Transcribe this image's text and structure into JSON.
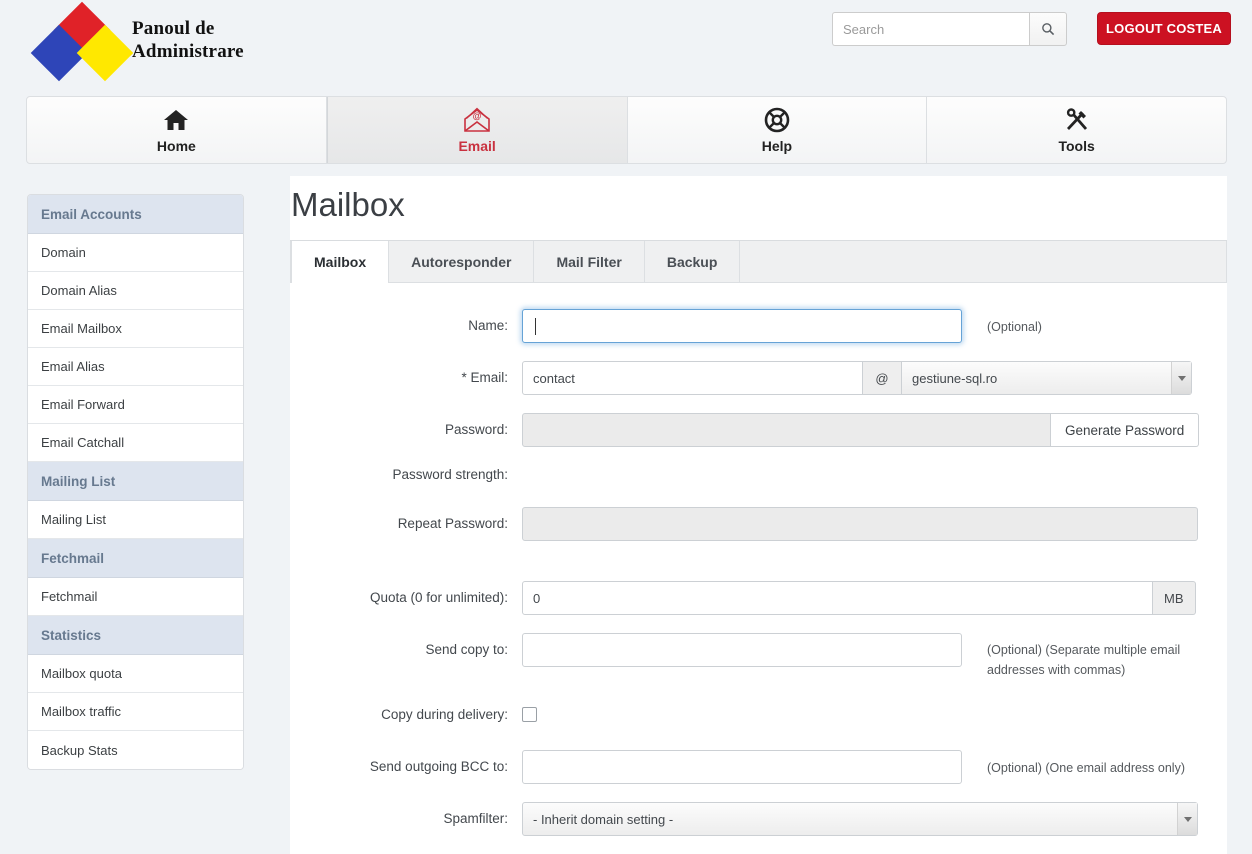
{
  "header": {
    "logo_text_line1": "Panoul de",
    "logo_text_line2": "Administrare",
    "search_placeholder": "Search",
    "search_value": "",
    "search_icon": "search-icon",
    "logout_label": "LOGOUT COSTEA",
    "logout_color": "#cc1122"
  },
  "mainnav": {
    "active_color": "#c9313f",
    "items": [
      {
        "label": "Home",
        "icon": "home-icon",
        "active": false
      },
      {
        "label": "Email",
        "icon": "envelope-at-icon",
        "active": true
      },
      {
        "label": "Help",
        "icon": "lifebuoy-icon",
        "active": false
      },
      {
        "label": "Tools",
        "icon": "tools-icon",
        "active": false
      }
    ]
  },
  "sidebar": {
    "groups": [
      {
        "header": "Email Accounts",
        "items": [
          "Domain",
          "Domain Alias",
          "Email Mailbox",
          "Email Alias",
          "Email Forward",
          "Email Catchall"
        ]
      },
      {
        "header": "Mailing List",
        "items": [
          "Mailing List"
        ]
      },
      {
        "header": "Fetchmail",
        "items": [
          "Fetchmail"
        ]
      },
      {
        "header": "Statistics",
        "items": [
          "Mailbox quota",
          "Mailbox traffic",
          "Backup Stats"
        ]
      }
    ]
  },
  "main": {
    "title": "Mailbox",
    "tabs": [
      {
        "label": "Mailbox",
        "active": true
      },
      {
        "label": "Autoresponder",
        "active": false
      },
      {
        "label": "Mail Filter",
        "active": false
      },
      {
        "label": "Backup",
        "active": false
      }
    ],
    "form": {
      "name": {
        "label": "Name:",
        "value": "",
        "hint": "(Optional)",
        "focused": true
      },
      "email": {
        "label": "* Email:",
        "value": "contact",
        "addon": "@",
        "domain_selected": "gestiune-sql.ro"
      },
      "password": {
        "label": "Password:",
        "value": "",
        "disabled": true,
        "generate_label": "Generate Password"
      },
      "password_strength": {
        "label": "Password strength:",
        "value": ""
      },
      "repeat_password": {
        "label": "Repeat Password:",
        "value": "",
        "disabled": true
      },
      "quota": {
        "label": "Quota (0 for unlimited):",
        "value": "0",
        "unit": "MB"
      },
      "send_copy_to": {
        "label": "Send copy to:",
        "value": "",
        "hint": "(Optional) (Separate multiple email addresses with commas)"
      },
      "copy_during_delivery": {
        "label": "Copy during delivery:",
        "checked": false
      },
      "send_outgoing_bcc": {
        "label": "Send outgoing BCC to:",
        "value": "",
        "hint": "(Optional) (One email address only)"
      },
      "spamfilter": {
        "label": "Spamfilter:",
        "selected": "- Inherit domain setting -"
      }
    }
  }
}
